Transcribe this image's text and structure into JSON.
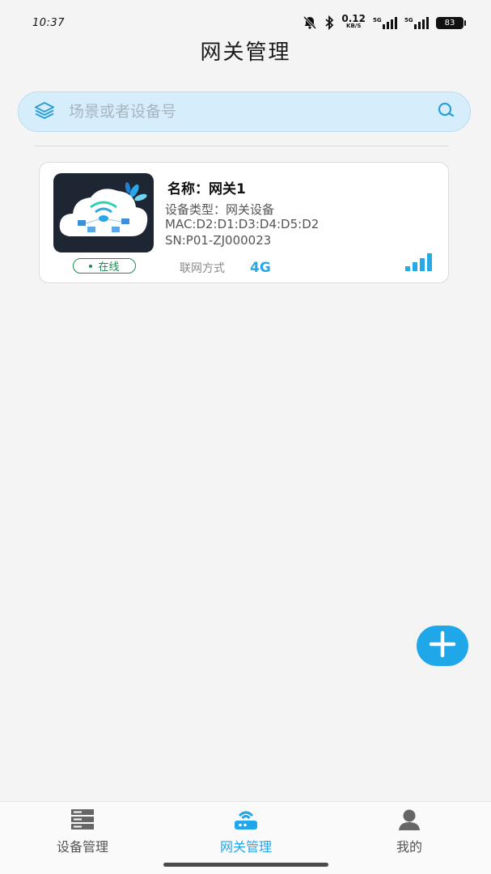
{
  "status_bar": {
    "time": "10:37",
    "speed_value": "0.12",
    "speed_unit": "KB/S",
    "network_1": "5G",
    "network_2": "5G",
    "battery": "83"
  },
  "header": {
    "title": "网关管理"
  },
  "search": {
    "placeholder": "场景或者设备号"
  },
  "gateways": [
    {
      "name": "名称：网关1",
      "type": "设备类型：网关设备",
      "mac": "MAC:D2:D1:D3:D4:D5:D2",
      "sn": "SN:P01-ZJ000023",
      "status": "在线",
      "connection_label": "联网方式",
      "connection_value": "4G",
      "signal_level": 4
    }
  ],
  "fab": {
    "icon": "plus-icon"
  },
  "tabs": [
    {
      "label": "设备管理",
      "icon": "server-icon",
      "active": false
    },
    {
      "label": "网关管理",
      "icon": "router-icon",
      "active": true
    },
    {
      "label": "我的",
      "icon": "user-icon",
      "active": false
    }
  ],
  "colors": {
    "accent": "#1fa7ea",
    "online": "#1f8a55",
    "search_bg": "#d6eefb"
  }
}
